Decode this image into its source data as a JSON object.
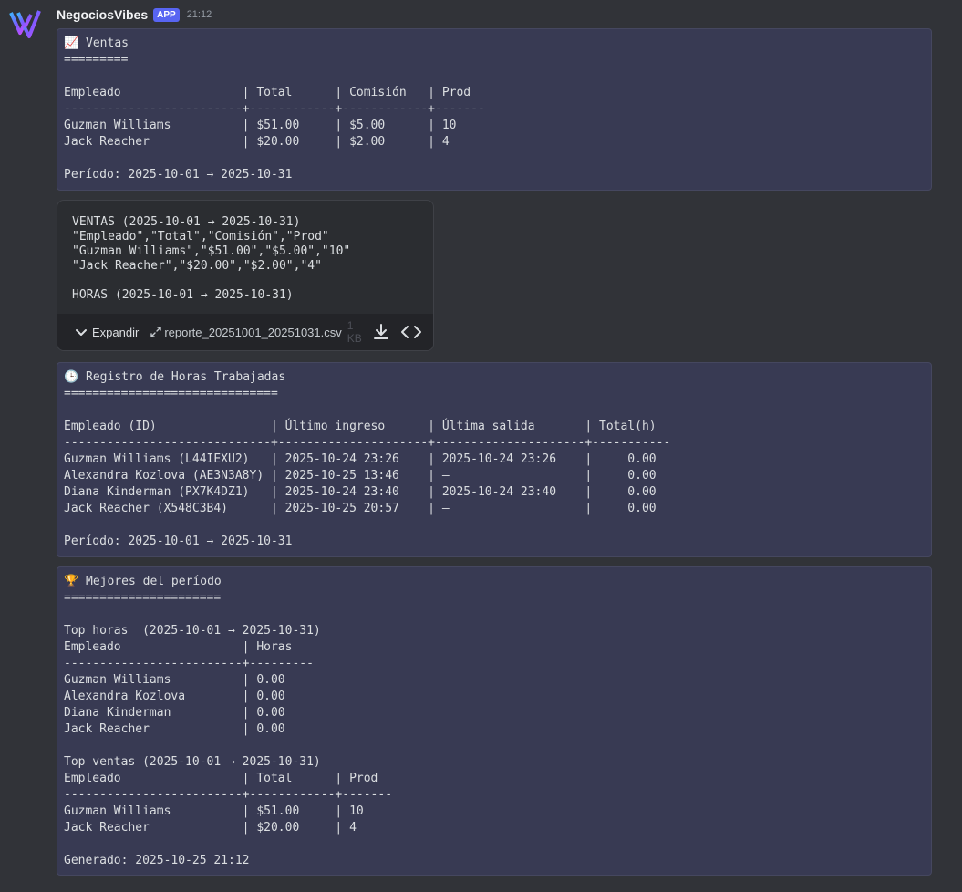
{
  "message": {
    "username": "NegociosVibes",
    "app_tag": "APP",
    "timestamp": "21:12"
  },
  "ventas_block": {
    "text": "📈 Ventas\n=========\n\nEmpleado                 | Total      | Comisión   | Prod\n-------------------------+------------+------------+-------\nGuzman Williams          | $51.00     | $5.00      | 10\nJack Reacher             | $20.00     | $2.00      | 4\n\nPeríodo: 2025-10-01 → 2025-10-31"
  },
  "attachment": {
    "preview": "VENTAS (2025-10-01 → 2025-10-31)\n\"Empleado\",\"Total\",\"Comisión\",\"Prod\"\n\"Guzman Williams\",\"$51.00\",\"$5.00\",\"10\"\n\"Jack Reacher\",\"$20.00\",\"$2.00\",\"4\"\n\nHORAS (2025-10-01 → 2025-10-31)",
    "expand_label": "Expandir",
    "filename": "reporte_20251001_20251031.csv",
    "filesize": "1 KB",
    "icons": [
      "chevron-down-icon",
      "external-link-icon",
      "download-icon",
      "code-icon"
    ]
  },
  "horas_block": {
    "text": "🕒 Registro de Horas Trabajadas\n==============================\n\nEmpleado (ID)                | Último ingreso      | Última salida       | Total(h)\n-----------------------------+---------------------+---------------------+-----------\nGuzman Williams (L44IEXU2)   | 2025-10-24 23:26    | 2025-10-24 23:26    |     0.00\nAlexandra Kozlova (AE3N3A8Y) | 2025-10-25 13:46    | —                   |     0.00\nDiana Kinderman (PX7K4DZ1)   | 2025-10-24 23:40    | 2025-10-24 23:40    |     0.00\nJack Reacher (X548C3B4)      | 2025-10-25 20:57    | —                   |     0.00\n\nPeríodo: 2025-10-01 → 2025-10-31"
  },
  "mejores_block": {
    "text": "🏆 Mejores del período\n======================\n\nTop horas  (2025-10-01 → 2025-10-31)\nEmpleado                 | Horas\n-------------------------+---------\nGuzman Williams          | 0.00\nAlexandra Kozlova        | 0.00\nDiana Kinderman          | 0.00\nJack Reacher             | 0.00\n\nTop ventas (2025-10-01 → 2025-10-31)\nEmpleado                 | Total      | Prod\n-------------------------+------------+-------\nGuzman Williams          | $51.00     | 10\nJack Reacher             | $20.00     | 4\n\nGenerado: 2025-10-25 21:12"
  },
  "colors": {
    "background": "#313338",
    "codeblock": "#383a53",
    "app_tag": "#5865f2"
  }
}
